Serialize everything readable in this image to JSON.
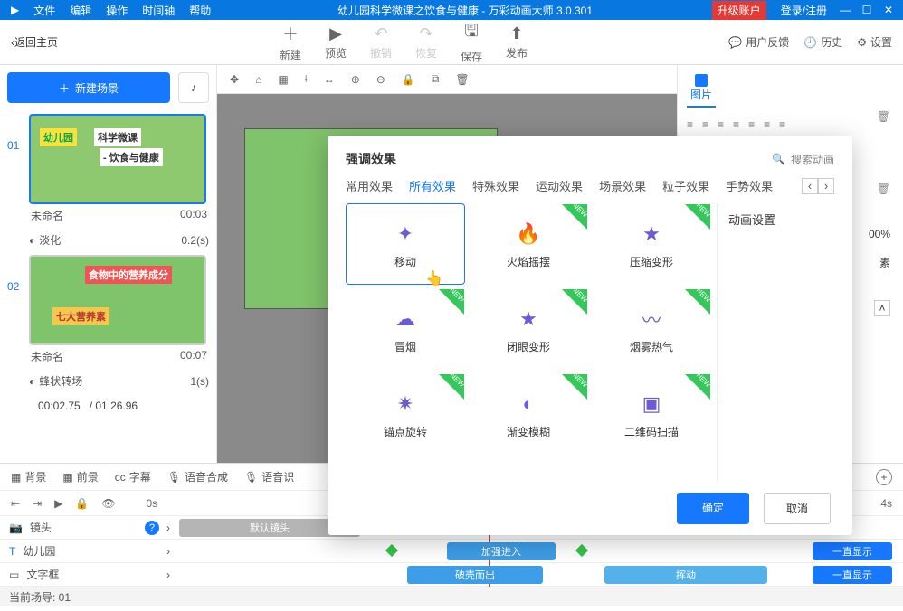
{
  "titlebar": {
    "logo": "▶",
    "menus": [
      "文件",
      "编辑",
      "操作",
      "时间轴",
      "帮助"
    ],
    "title": "幼儿园科学微课之饮食与健康 - 万彩动画大师 3.0.301",
    "upgrade": "升级账户",
    "login": "登录/注册",
    "min": "—",
    "max": "☐",
    "close": "✕"
  },
  "back": "返回主页",
  "toolbar": {
    "new": "新建",
    "preview": "预览",
    "undo": "撤销",
    "redo": "恢复",
    "save": "保存",
    "publish": "发布",
    "feedback": "用户反馈",
    "history": "历史",
    "settings": "设置"
  },
  "left": {
    "new_scene": "新建场景",
    "scene1": {
      "idx": "01",
      "badge1": "幼儿园",
      "badge2": "科学微课",
      "badge3": "- 饮食与健康",
      "name": "未命名",
      "dur": "00:03",
      "trans": "淡化",
      "trans_dur": "0.2(s)"
    },
    "scene2": {
      "idx": "02",
      "badge1": "食物中的营养成分",
      "badge2": "七大营养素",
      "name": "未命名",
      "dur": "00:07",
      "trans": "蜂状转场",
      "trans_dur": "1(s)"
    },
    "cur": "00:02.75",
    "total": "/ 01:26.96"
  },
  "right": {
    "tab": "图片",
    "percent": "00%",
    "unit": "素"
  },
  "popup": {
    "title": "强调效果",
    "search": "搜索动画",
    "tabs": [
      "常用效果",
      "所有效果",
      "特殊效果",
      "运动效果",
      "场景效果",
      "粒子效果",
      "手势效果"
    ],
    "active_tab": 1,
    "side": "动画设置",
    "items": [
      {
        "label": "移动",
        "new": false,
        "sel": true
      },
      {
        "label": "火焰摇摆",
        "new": true
      },
      {
        "label": "压缩变形",
        "new": true
      },
      {
        "label": "冒烟",
        "new": true
      },
      {
        "label": "闭眼变形",
        "new": true
      },
      {
        "label": "烟雾热气",
        "new": true
      },
      {
        "label": "锚点旋转",
        "new": true
      },
      {
        "label": "渐变模糊",
        "new": true
      },
      {
        "label": "二维码扫描",
        "new": true
      }
    ],
    "ok": "确定",
    "cancel": "取消"
  },
  "bottom": {
    "tabs": {
      "bg": "背景",
      "fg": "前景",
      "sub": "字幕",
      "tts": "语音合成",
      "rec": "语音识"
    },
    "ruler": {
      "s0": "0s",
      "s4": "4s"
    },
    "tracks": {
      "cam": {
        "name": "镜头",
        "clip": "默认镜头"
      },
      "txt1": {
        "name": "幼儿园",
        "enter": "加强进入",
        "always": "一直显示"
      },
      "txt2": {
        "name": "文字框",
        "clip": "破壳而出",
        "move": "挥动",
        "always": "一直显示"
      }
    },
    "footer": "当前场导: 01"
  }
}
